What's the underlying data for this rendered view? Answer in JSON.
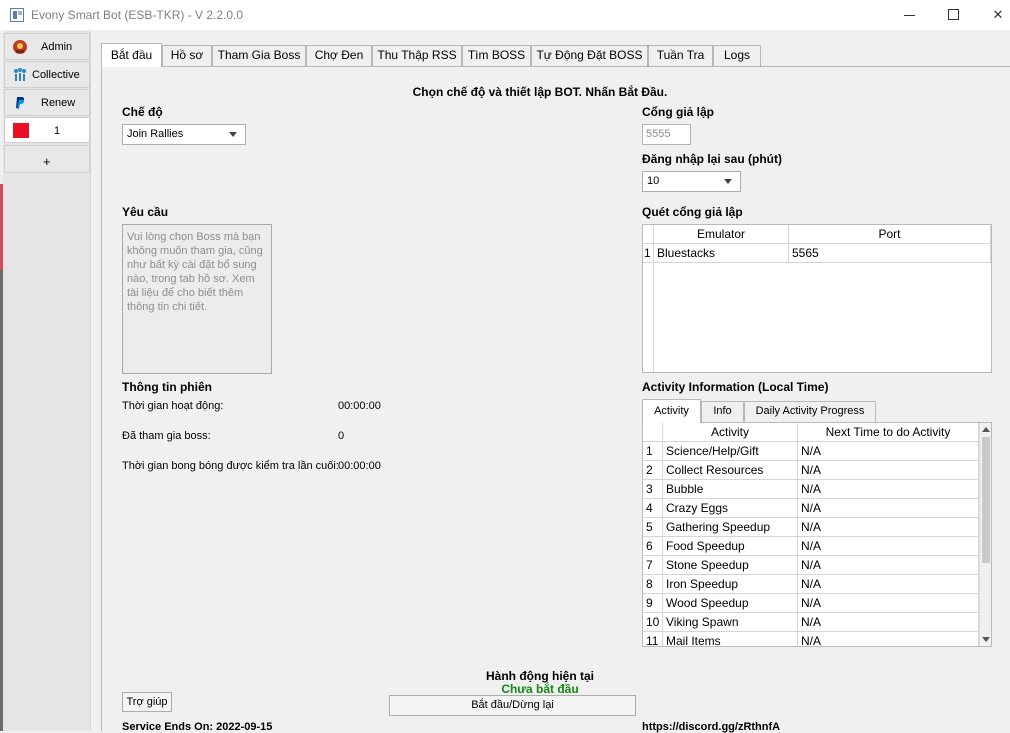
{
  "window": {
    "title": "Evony Smart Bot (ESB-TKR) - V 2.2.0.0"
  },
  "sidebar": {
    "items": [
      {
        "label": "Admin",
        "icon": "admin-avatar-icon"
      },
      {
        "label": "Collective",
        "icon": "people-icon"
      },
      {
        "label": "Renew",
        "icon": "paypal-icon"
      },
      {
        "label": "1",
        "color": "#e81123"
      },
      {
        "label": "+"
      }
    ]
  },
  "tabs": [
    "Bắt đầu",
    "Hồ sơ",
    "Tham Gia Boss",
    "Chợ Đen",
    "Thu Thập RSS",
    "Tìm BOSS",
    "Tự Động Đặt BOSS",
    "Tuần Tra",
    "Logs"
  ],
  "main": {
    "headline": "Chọn chế độ và thiết lập BOT. Nhấn Bắt Đầu.",
    "mode_label": "Chế độ",
    "mode_value": "Join Rallies",
    "emulator_port_label": "Cổng giả lập",
    "emulator_port_placeholder": "5555",
    "relogin_label": "Đăng nhập lại sau (phút)",
    "relogin_value": "10",
    "requirement_label": "Yêu cầu",
    "requirement_text": "Vui lòng chọn Boss mà bạn không muốn tham gia, cũng như bất kỳ cài đặt bổ sung nào, trong tab hồ sơ. Xem tài liệu để cho biết thêm thông tin chi tiết.",
    "scan_label": "Quét cổng giả lập",
    "scan_headers": [
      "Emulator",
      "Port"
    ],
    "scan_rows": [
      {
        "num": "1",
        "emulator": "Bluestacks",
        "port": "5565"
      }
    ],
    "session_label": "Thông tin phiên",
    "session": [
      {
        "label": "Thời gian hoạt động:",
        "value": "00:00:00"
      },
      {
        "label": "Đã tham gia boss:",
        "value": "0"
      },
      {
        "label": "Thời gian bong bóng được kiểm tra lần cuối:",
        "value": "00:00:00"
      }
    ],
    "activity_label": "Activity Information (Local Time)",
    "activity_tabs": [
      "Activity",
      "Info",
      "Daily Activity Progress"
    ],
    "activity_headers": [
      "Activity",
      "Next Time to do Activity"
    ],
    "activity_rows": [
      {
        "num": "1",
        "activity": "Science/Help/Gift",
        "next": "N/A"
      },
      {
        "num": "2",
        "activity": "Collect Resources",
        "next": "N/A"
      },
      {
        "num": "3",
        "activity": "Bubble",
        "next": "N/A"
      },
      {
        "num": "4",
        "activity": "Crazy Eggs",
        "next": "N/A"
      },
      {
        "num": "5",
        "activity": "Gathering Speedup",
        "next": "N/A"
      },
      {
        "num": "6",
        "activity": "Food Speedup",
        "next": "N/A"
      },
      {
        "num": "7",
        "activity": "Stone Speedup",
        "next": "N/A"
      },
      {
        "num": "8",
        "activity": "Iron Speedup",
        "next": "N/A"
      },
      {
        "num": "9",
        "activity": "Wood Speedup",
        "next": "N/A"
      },
      {
        "num": "10",
        "activity": "Viking Spawn",
        "next": "N/A"
      },
      {
        "num": "11",
        "activity": "Mail Items",
        "next": "N/A"
      }
    ],
    "current_action_label": "Hành động hiện tại",
    "current_action_status": "Chưa bắt đầu",
    "start_stop_button": "Bắt đầu/Dừng lại",
    "help_button": "Trợ giúp",
    "service_ends": "Service Ends On: 2022-09-15",
    "discord": "https://discord.gg/zRthnfA"
  }
}
